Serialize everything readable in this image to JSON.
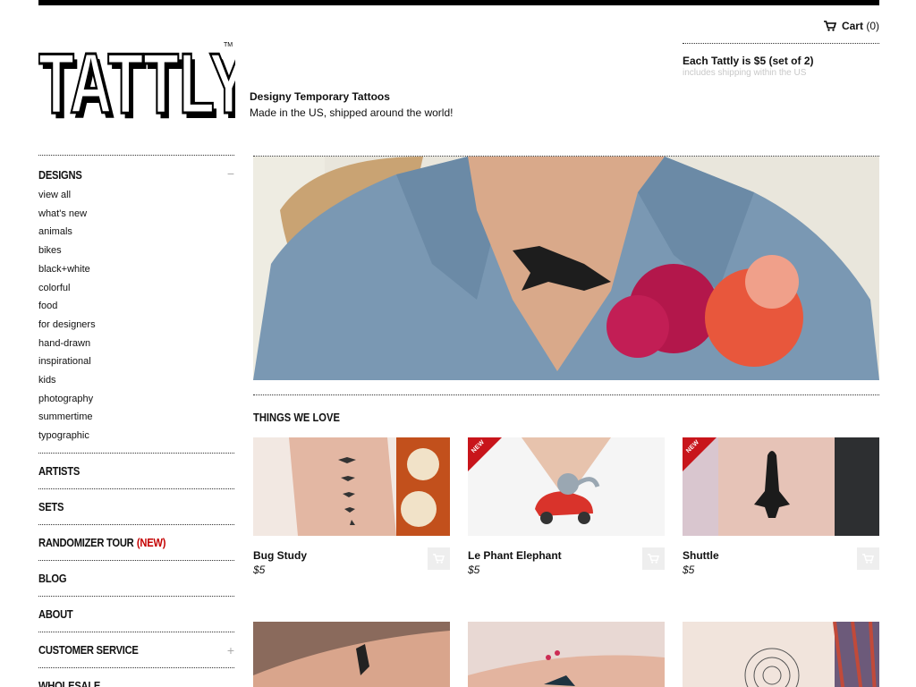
{
  "header": {
    "cart_label": "Cart",
    "cart_count": "(0)",
    "price_main": "Each Tattly is $5 (set of 2)",
    "price_sub": "includes shipping within the US",
    "tagline_1": "Designy Temporary Tattoos",
    "tagline_2": "Made in the US, shipped around the world!",
    "logo_text": "TATTLY",
    "logo_tm": "TM"
  },
  "sidebar": {
    "designs": {
      "label": "Designs",
      "toggle": "−",
      "items": [
        "view all",
        "what's new",
        "animals",
        "bikes",
        "black+white",
        "colorful",
        "food",
        "for designers",
        "hand-drawn",
        "inspirational",
        "kids",
        "photography",
        "summertime",
        "typographic"
      ]
    },
    "artists": "Artists",
    "sets": "Sets",
    "randomizer": "Randomizer Tour",
    "randomizer_new": "(New)",
    "blog": "Blog",
    "about": "About",
    "customer_service": "Customer Service",
    "customer_service_toggle": "+",
    "wholesale": "Wholesale"
  },
  "main": {
    "section_title": "Things We Love",
    "products": [
      {
        "name": "Bug Study",
        "price": "$5",
        "is_new": false
      },
      {
        "name": "Le Phant Elephant",
        "price": "$5",
        "is_new": true,
        "badge": "NEW"
      },
      {
        "name": "Shuttle",
        "price": "$5",
        "is_new": true,
        "badge": "NEW"
      }
    ]
  },
  "colors": {
    "accent_red": "#c8151b",
    "text": "#111111",
    "muted": "#c8c8c8"
  }
}
